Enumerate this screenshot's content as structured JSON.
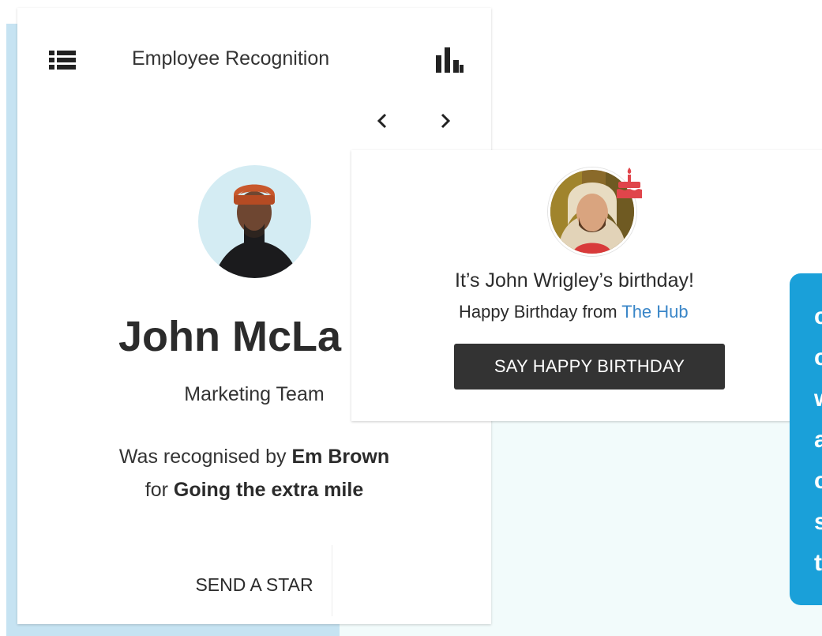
{
  "colors": {
    "accent_blue": "#1aa0d9",
    "link_blue": "#3a86c8",
    "button_dark": "#333333",
    "backdrop_light_blue": "#c6e3f2",
    "backdrop_mint": "#f2fbfb",
    "cake_red": "#e0454b"
  },
  "recognition_card": {
    "header": {
      "menu_icon": "list-icon",
      "title": "Employee Recognition",
      "stats_icon": "bar-chart-icon"
    },
    "navigation": {
      "prev_icon": "chevron-left-icon",
      "next_icon": "chevron-right-icon"
    },
    "employee": {
      "name": "John McLa",
      "team": "Marketing Team"
    },
    "recognition": {
      "prefix": "Was recognised by",
      "recogniser": "Em Brown",
      "for_word": "for",
      "reason": "Going the extra mile"
    },
    "action_label": "SEND A STAR"
  },
  "birthday_card": {
    "badge_icon": "birthday-cake-icon",
    "title": "It’s John Wrigley’s birthday!",
    "subtitle_prefix": "Happy Birthday from",
    "subtitle_link": "The Hub",
    "action_label": "SAY HAPPY BIRTHDAY"
  },
  "side_tile": {
    "fragments": [
      "c",
      "c",
      "w",
      "a",
      "c",
      "s",
      "t"
    ]
  }
}
